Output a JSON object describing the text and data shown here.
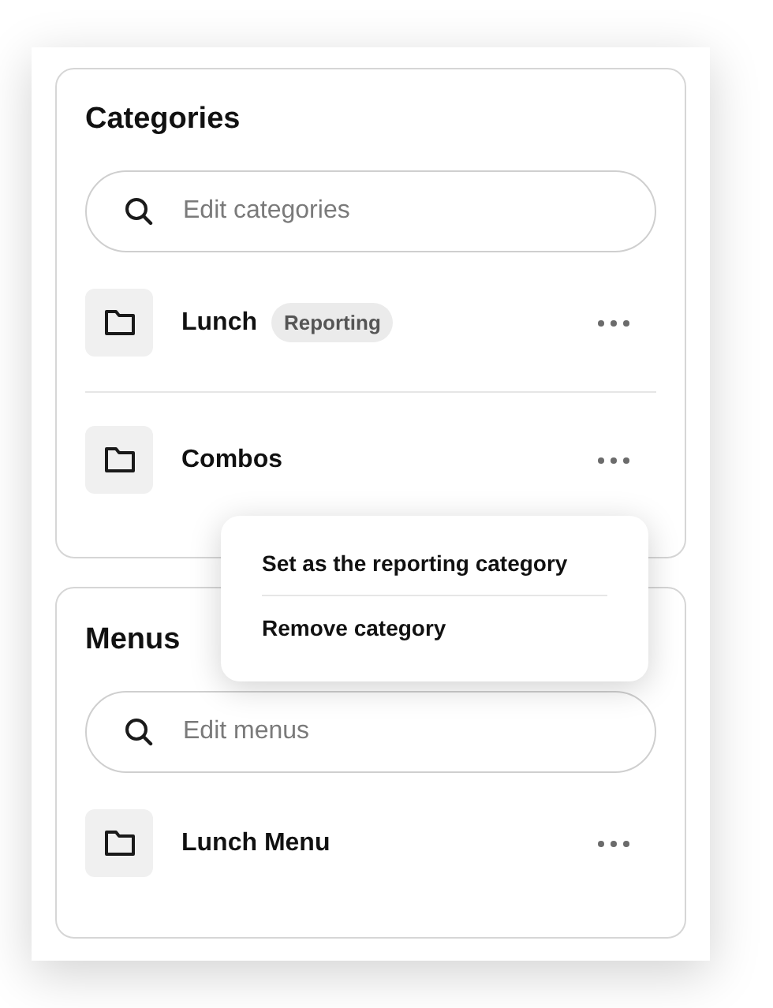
{
  "sections": [
    {
      "title": "Categories",
      "search": {
        "placeholder": "Edit categories"
      },
      "items": [
        {
          "name": "Lunch",
          "badge": "Reporting"
        },
        {
          "name": "Combos"
        }
      ]
    },
    {
      "title": "Menus",
      "search": {
        "placeholder": "Edit menus"
      },
      "items": [
        {
          "name": "Lunch Menu"
        }
      ]
    }
  ],
  "context_menu": {
    "items": [
      "Set as the reporting category",
      "Remove category"
    ]
  }
}
